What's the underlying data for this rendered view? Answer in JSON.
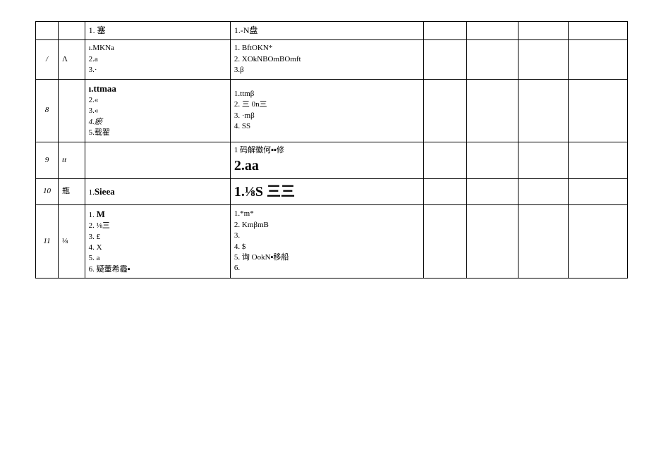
{
  "rows": [
    {
      "num": "",
      "sym": "",
      "a_html": "<span class='hdr'>1. 塞</span>",
      "b_html": "<span class='hdr'>1.-N盘</span>"
    },
    {
      "num": "/",
      "sym": "Λ",
      "a_html": "ı.MKNa\n2.a\n3.·",
      "b_html": "1. BftOKN*\n2. XOkNBOmBOmft\n3.β"
    },
    {
      "num": "8",
      "sym": "",
      "a_html": "<span class='bold' style='font-size:13px'>ı.ttmaa</span>\n2.«\n3.«\n<span class='italic'>4.瘀</span>\n5.载翟",
      "b_html": "1.ttmβ\n2. 三 0n三\n3. ·mβ\n4. SS"
    },
    {
      "num": "9",
      "sym": "tt",
      "sym_italic": true,
      "a_html": "",
      "b_html": "1 码解徽何▪▪修\n<span class='bigger'>2.aa</span>"
    },
    {
      "num": "10",
      "sym": "瓶",
      "a_html": "1.<span class='bold' style='font-size:13px'>Sieea</span>",
      "b_html": "<span class='bigger'>1.⅛S 三三</span>"
    },
    {
      "num": "11",
      "sym": "⅛",
      "a_html": "1. <span class='bold' style='font-size:13px'>M</span>\n2. ⅛三\n3. £\n4. X\n5. a\n6. 疑董希霾▪",
      "b_html": "1.*m*\n2. KmβmB\n3.\n4. $\n5. 询 OokN▪移船\n6."
    }
  ]
}
